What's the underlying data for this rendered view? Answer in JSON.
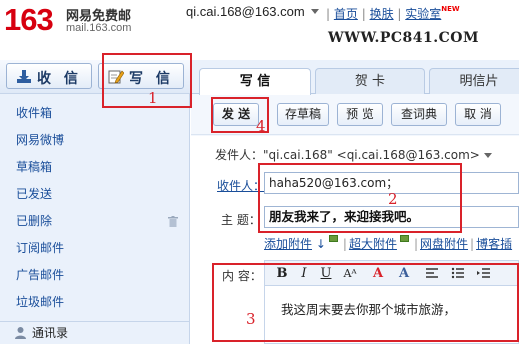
{
  "header": {
    "logo_number": "163",
    "logo_cn": "网易免费邮",
    "logo_domain": "mail.163.com",
    "account": "qi.cai.168@163.com",
    "links": [
      "首页",
      "换肤",
      "实验室"
    ],
    "new_badge": "NEW",
    "watermark": "WWW.PC841.COM"
  },
  "sidebar": {
    "receive_button": "收 信",
    "write_button": "写 信",
    "folders": [
      "收件箱",
      "网易微博",
      "草稿箱",
      "已发送",
      "已删除",
      "订阅邮件",
      "广告邮件",
      "垃圾邮件"
    ],
    "contacts": "通讯录"
  },
  "tabs": [
    "写 信",
    "贺 卡",
    "明信片"
  ],
  "toolbar": {
    "send": "发 送",
    "save_draft": "存草稿",
    "preview": "预 览",
    "dictionary": "查词典",
    "cancel": "取 消"
  },
  "compose": {
    "sender_label": "发件人：",
    "sender_value": "\"qi.cai.168\" <qi.cai.168@163.com>",
    "to_label": "收件人：",
    "to_value": "haha520@163.com；",
    "subject_label": "主 题：",
    "subject_value": "朋友我来了，来迎接我吧。",
    "attach_add": "添加附件",
    "attach_large": "超大附件",
    "attach_web": "网盘附件",
    "attach_more": "博客插",
    "content_label": "内 容：",
    "body_text": "我这周末要去你那个城市旅游，"
  },
  "annotations": [
    "1",
    "2",
    "3",
    "4"
  ],
  "colors": {
    "brand_red": "#d7000f",
    "link_blue": "#1a4e9a",
    "annotation_red": "#d9222a",
    "sidebar_bg": "#eaf1fb"
  }
}
